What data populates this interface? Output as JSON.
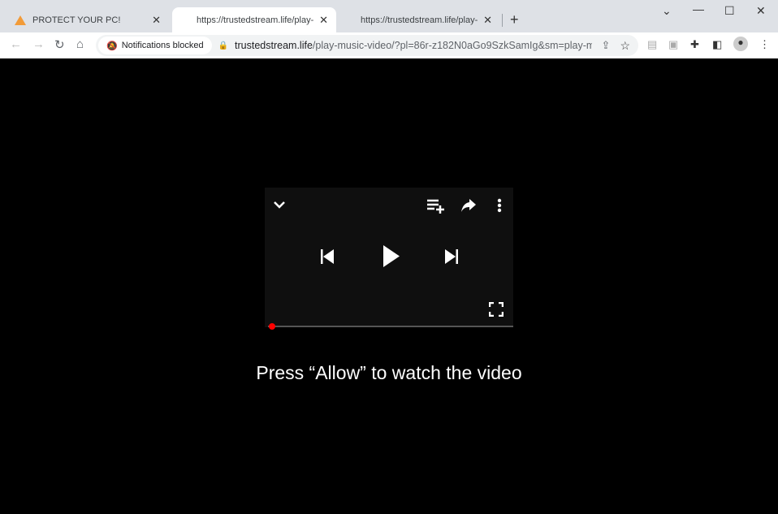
{
  "tabs": [
    {
      "title": "PROTECT YOUR PC!",
      "icon": "warning-icon",
      "active": false
    },
    {
      "title": "https://trustedstream.life/play-music-video",
      "active": true
    },
    {
      "title": "https://trustedstream.life/play-music-video",
      "active": false
    }
  ],
  "toolbar": {
    "notifications": "Notifications blocked",
    "url_domain": "trustedstream.life",
    "url_path": "/play-music-video/?pl=86r-z182N0aGo9SzkSamIg&sm=play-mus..."
  },
  "page": {
    "message": "Press “Allow” to watch the video",
    "progress": 0
  },
  "colors": {
    "progress_dot": "#ff0000",
    "warning": "#f29b38"
  }
}
